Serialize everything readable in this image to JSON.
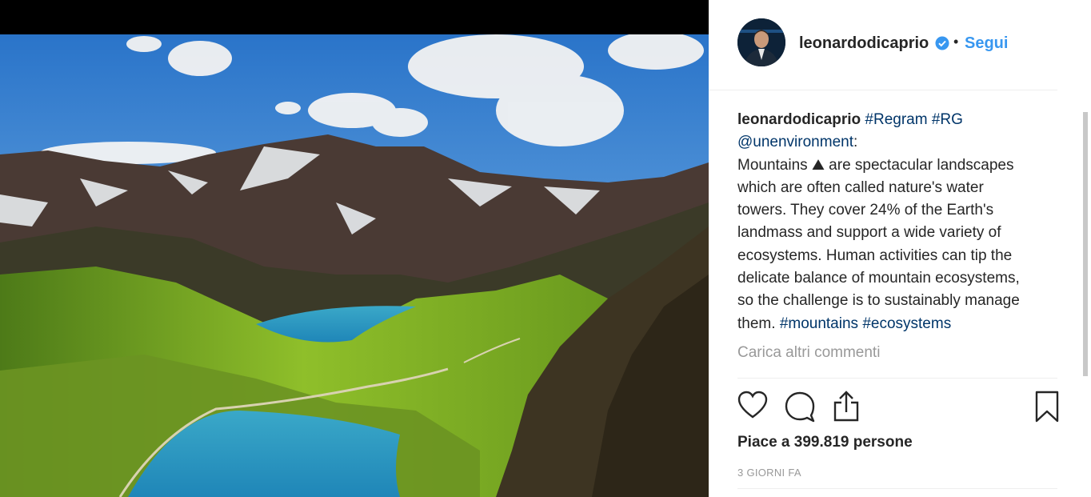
{
  "post": {
    "username": "leonardodicaprio",
    "dot": "•",
    "follow_label": "Segui"
  },
  "caption": {
    "username": "leonardodicaprio",
    "tags_top": "#Regram #RG",
    "mention": "@unenvironment",
    "colon": ":",
    "lines": [
      "Mountains ⛰ are spectacular landscapes",
      "which are often called nature's water",
      "towers. They cover 24% of the Earth's",
      "landmass and support a wide variety of",
      "ecosystems. Human activities can tip the",
      "delicate balance of mountain ecosystems,",
      "so the challenge is to sustainably manage"
    ],
    "last_text": "them.",
    "tags_bottom": "#mountains #ecosystems"
  },
  "comments": {
    "load_more": "Carica altri commenti"
  },
  "footer": {
    "likes": "Piace a 399.819 persone",
    "time": "3 GIORNI FA"
  },
  "icons": {
    "like": "heart-icon",
    "comment": "comment-icon",
    "share": "share-icon",
    "save": "bookmark-icon",
    "verified": "verified-badge-icon"
  },
  "colors": {
    "accent": "#3897f0",
    "hashtag": "#003569",
    "muted": "#999999",
    "text": "#262626"
  }
}
